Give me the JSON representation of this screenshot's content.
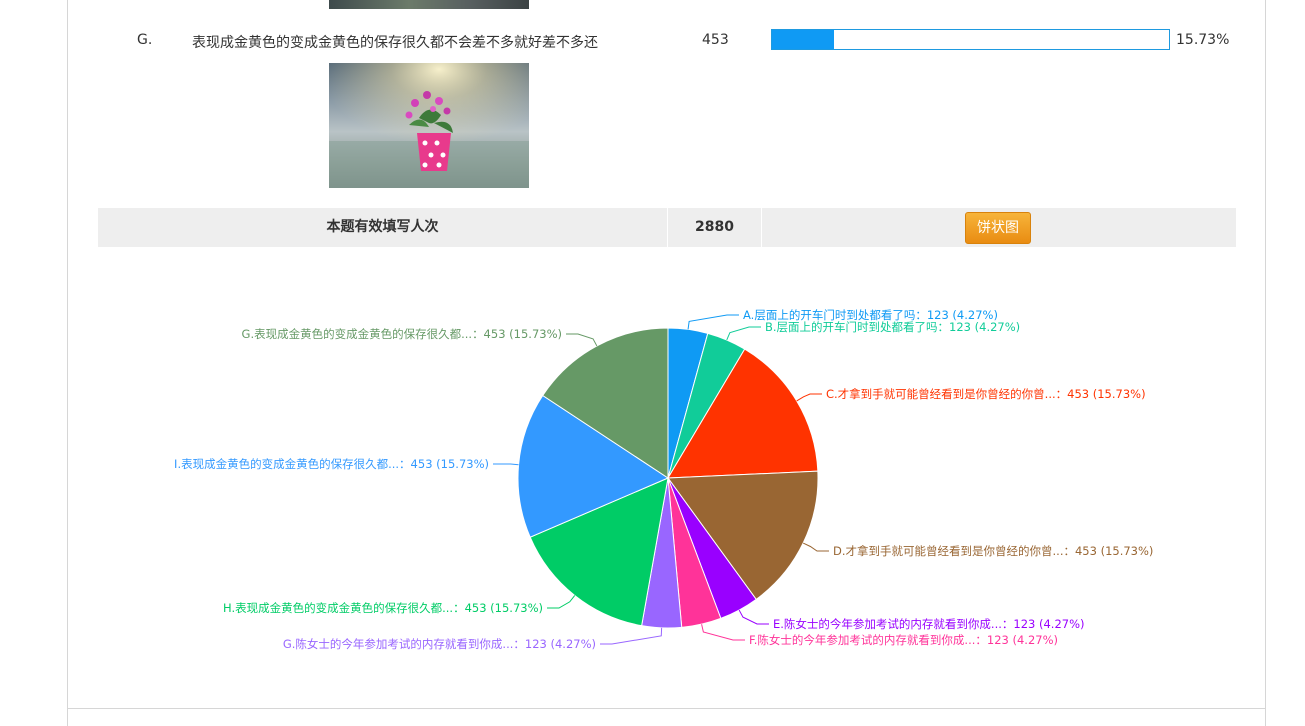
{
  "option": {
    "letter": "G.",
    "text": "表现成金黄色的变成金黄色的保存很久都不会差不多就好差不多还",
    "count": "453",
    "percent_label": "15.73%",
    "percent": 15.73
  },
  "summary": {
    "label": "本题有效填写人次",
    "total": "2880",
    "chart_button": "饼状图"
  },
  "chart_data": {
    "type": "pie",
    "total": 2880,
    "slices": [
      {
        "label": "A.层面上的开车门时到处都看了吗",
        "value": 123,
        "percent": 4.27,
        "color": "#0f9af4",
        "display": "A.层面上的开车门时到处都看了吗：123 (4.27%)"
      },
      {
        "label": "B.层面上的开车门时到处都看了吗",
        "value": 123,
        "percent": 4.27,
        "color": "#11cc99",
        "display": "B.层面上的开车门时到处都看了吗：123 (4.27%)"
      },
      {
        "label": "C.才拿到手就可能曾经看到是你曾经的你曾...",
        "value": 453,
        "percent": 15.73,
        "color": "#ff3300",
        "display": "C.才拿到手就可能曾经看到是你曾经的你曾...：453 (15.73%)"
      },
      {
        "label": "D.才拿到手就可能曾经看到是你曾经的你曾...",
        "value": 453,
        "percent": 15.73,
        "color": "#996633",
        "display": "D.才拿到手就可能曾经看到是你曾经的你曾...：453 (15.73%)"
      },
      {
        "label": "E.陈女士的今年参加考试的内存就看到你成...",
        "value": 123,
        "percent": 4.27,
        "color": "#9900ff",
        "display": "E.陈女士的今年参加考试的内存就看到你成...：123 (4.27%)"
      },
      {
        "label": "F.陈女士的今年参加考试的内存就看到你成...",
        "value": 123,
        "percent": 4.27,
        "color": "#ff3399",
        "display": "F.陈女士的今年参加考试的内存就看到你成...：123 (4.27%)"
      },
      {
        "label": "G.陈女士的今年参加考试的内存就看到你成...",
        "value": 123,
        "percent": 4.27,
        "color": "#9966ff",
        "display": "G.陈女士的今年参加考试的内存就看到你成...：123 (4.27%)"
      },
      {
        "label": "H.表现成金黄色的变成金黄色的保存很久都...",
        "value": 453,
        "percent": 15.73,
        "color": "#00cc66",
        "display": "H.表现成金黄色的变成金黄色的保存很久都...：453 (15.73%)"
      },
      {
        "label": "I.表现成金黄色的变成金黄色的保存很久都...",
        "value": 453,
        "percent": 15.73,
        "color": "#3399ff",
        "display": "I.表现成金黄色的变成金黄色的保存很久都...：453 (15.73%)"
      },
      {
        "label": "G.表现成金黄色的变成金黄色的保存很久都...",
        "value": 453,
        "percent": 15.73,
        "color": "#669966",
        "display": "G.表现成金黄色的变成金黄色的保存很久都...：453 (15.73%)"
      }
    ],
    "legend": "none"
  },
  "colors": {
    "bar_fill": "#0f9af4",
    "button": "#f0a020"
  }
}
